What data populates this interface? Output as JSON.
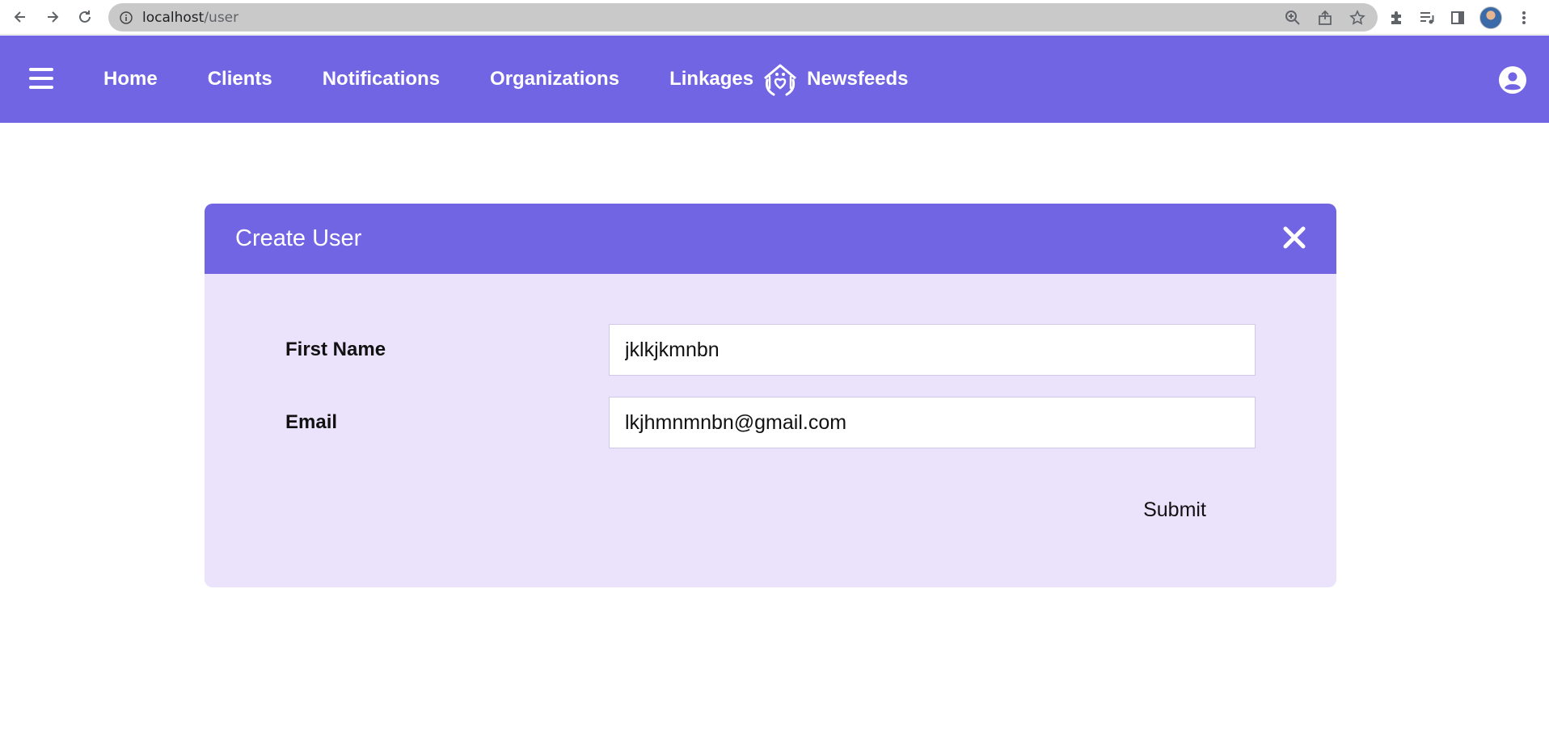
{
  "browser": {
    "url_host": "localhost",
    "url_path": "/user"
  },
  "navbar": {
    "links": [
      {
        "label": "Home"
      },
      {
        "label": "Clients"
      },
      {
        "label": "Notifications"
      },
      {
        "label": "Organizations"
      },
      {
        "label": "Linkages"
      },
      {
        "label": "Newsfeeds"
      }
    ],
    "logo_icon": "house-hands-heart-icon",
    "account_icon": "account-circle-icon",
    "menu_icon": "hamburger-menu-icon"
  },
  "modal": {
    "title": "Create User",
    "close_icon": "close-icon",
    "fields": {
      "first_name": {
        "label": "First Name",
        "value": "jklkjkmnbn"
      },
      "email": {
        "label": "Email",
        "value": "lkjhmnmnbn@gmail.com"
      }
    },
    "submit_label": "Submit"
  },
  "colors": {
    "accent": "#7165e3",
    "modal_body": "#ebe3fc",
    "omnibox": "#c9c9c9"
  }
}
